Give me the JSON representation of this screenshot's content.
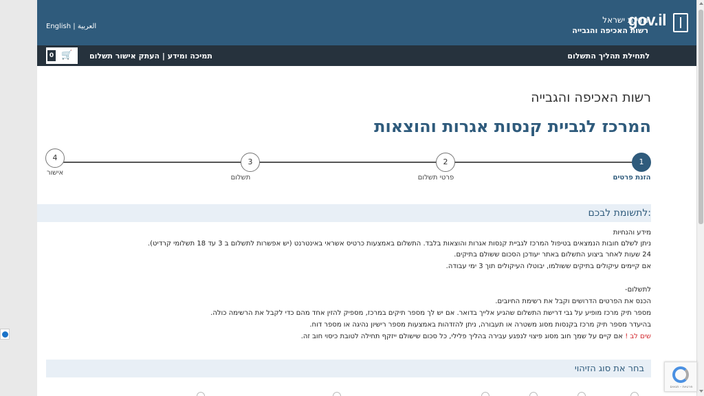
{
  "header": {
    "lang_en": "English",
    "lang_sep": "|",
    "lang_ar": "العربية",
    "state_name": "מדינת ישראל",
    "authority_name": "רשות האכיפה והגבייה",
    "logo_text": "gov.il",
    "brand_color": "#2f5b7c"
  },
  "nav": {
    "start_process": "לתחילת תהליך התשלום",
    "support_links": "תמיכה ומידע | העתק אישור תשלום",
    "cart_count": "0",
    "cart_icon": "shopping-cart-icon"
  },
  "page": {
    "authority_title": "רשות האכיפה והגבייה",
    "center_title": "המרכז לגביית קנסות אגרות והוצאות"
  },
  "steps": [
    {
      "number": "1",
      "label": "הזנת פרטים",
      "active": true
    },
    {
      "number": "2",
      "label": "פרטי תשלום",
      "active": false
    },
    {
      "number": "3",
      "label": "תשלום",
      "active": false
    },
    {
      "number": "4",
      "label": "אישור",
      "active": false
    }
  ],
  "attention": {
    "title": "לתשומת לבכם:",
    "lines": [
      "מידע והנחיות",
      "ניתן לשלם חובות הנמצאים בטיפול המרכז לגביית קנסות אגרות והוצאות בלבד. התשלום באמצעות כרטיס אשראי באינטרנט (יש אפשרות לתשלום ב 3 עד 18 תשלומי קרדיט).",
      "24 שעות לאחר ביצוע התשלום באתר יעודכן הסכום ששולם בתיקים.",
      "אם קיימים עיקולים בתיקים ששולמו, יבוטלו העיקולים תוך 3 ימי עבודה.",
      "לתשלום-",
      "הכנס את הפרטים הדרושים וקבל את רשימת החיובים.",
      "מספר תיק מרכז מופיע על גבי דרישת התשלום שהגיע אלייך בדואר. אם יש לך מספר תיקים במרכז, מספיק להזין אחד מהם כדי לקבל את הרשימה כולה.",
      "בהיעדר מספר תיק מרכז בקנסות מסוג משטרה או תעבורה, ניתן להזדהות באמצעות מספר רישיון נהיגה או מספר דוח."
    ],
    "warning_label": "שים לב",
    "warning_mark": "!",
    "warning_text": "אם קיים על שמך חוב מסוג פיצוי לנפגע עבירה בהליך פלילי, כל סכום שישולם ייזקף תחילה לטובת כיסוי חוב זה."
  },
  "identification": {
    "title": "בחר את סוג הזיהוי"
  },
  "recaptcha": {
    "footer": "פרטיות - תנאים"
  }
}
